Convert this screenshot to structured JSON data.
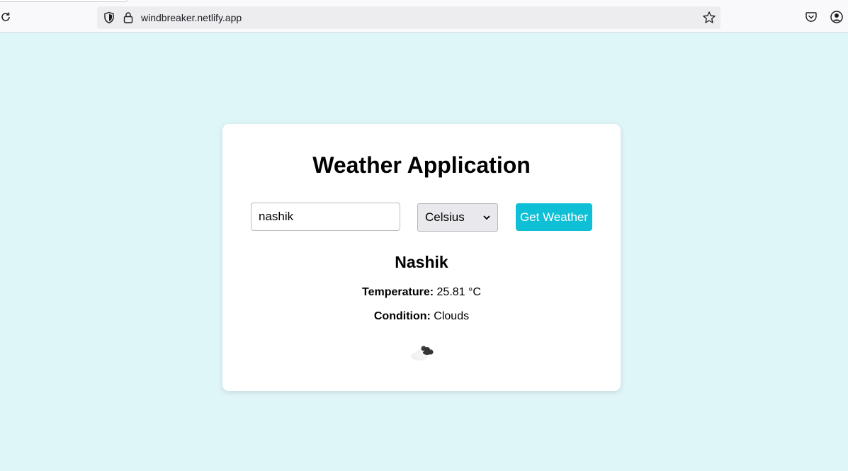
{
  "browser": {
    "url": "windbreaker.netlify.app",
    "icons": [
      "reload-icon",
      "shield-icon",
      "lock-icon",
      "star-icon",
      "pocket-icon",
      "account-icon"
    ]
  },
  "app": {
    "title": "Weather Application",
    "city_input_value": "nashik",
    "unit_selected": "Celsius",
    "get_weather_label": "Get Weather",
    "button_color": "#0fbfd6",
    "background_color": "#dff6f8"
  },
  "result": {
    "city": "Nashik",
    "temperature_label": "Temperature:",
    "temperature_value": "25.81 °C",
    "condition_label": "Condition:",
    "condition_value": "Clouds",
    "icon": "clouds-icon"
  }
}
